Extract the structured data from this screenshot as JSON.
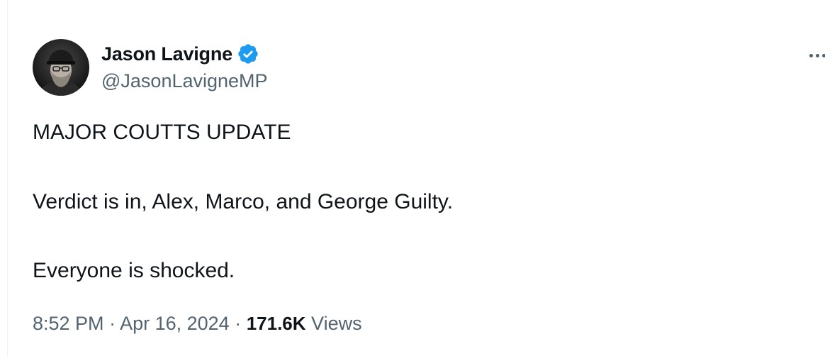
{
  "author": {
    "display_name": "Jason Lavigne",
    "handle": "@JasonLavigneMP",
    "verified": true,
    "verified_color": "#1d9bf0"
  },
  "tweet": {
    "lines": [
      "MAJOR COUTTS UPDATE",
      "Verdict is in, Alex, Marco, and George Guilty.",
      "Everyone is shocked."
    ]
  },
  "meta": {
    "time": "8:52 PM",
    "separator": " · ",
    "date": "Apr 16, 2024",
    "views_count": "171.6K",
    "views_label": " Views"
  },
  "icons": {
    "more": "more-dots-icon",
    "verified": "verified-badge-icon"
  }
}
